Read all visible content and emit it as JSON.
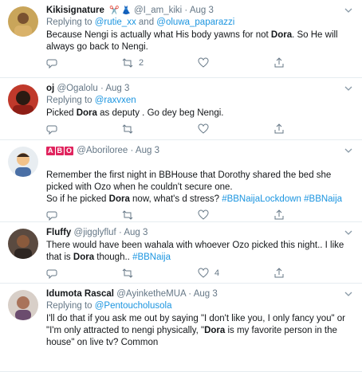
{
  "colors": {
    "link": "#1b95e0",
    "muted": "#657786",
    "divider": "#e6ecf0"
  },
  "tweets": [
    {
      "name": "Kikisignature",
      "emoji": "✂️ 👗",
      "handle": "@I_am_kiki",
      "sep": "·",
      "date": "Aug 3",
      "replying_prefix": "Replying to",
      "replying_handles": [
        "@rutie_xx",
        "and",
        "@oluwa_paparazzi"
      ],
      "body_segments": [
        {
          "t": "Because Nengi is actually what His body yawns for not ",
          "s": "n"
        },
        {
          "t": "Dora",
          "s": "b"
        },
        {
          "t": ". So He will always go back to Nengi.",
          "s": "n"
        }
      ],
      "counts": {
        "reply": "",
        "retweet": "2",
        "like": ""
      }
    },
    {
      "name": "oj",
      "handle": "@Ogalolu",
      "sep": "·",
      "date": "Aug 3",
      "replying_prefix": "Replying to",
      "replying_handles": [
        "@raxvxen"
      ],
      "body_segments": [
        {
          "t": "Picked ",
          "s": "n"
        },
        {
          "t": "Dora",
          "s": "b"
        },
        {
          "t": " as deputy . Go dey beg Nengi.",
          "s": "n"
        }
      ],
      "counts": {
        "reply": "",
        "retweet": "",
        "like": ""
      }
    },
    {
      "name_badges": [
        "A",
        "B",
        "O"
      ],
      "handle": "@Aboriloree",
      "sep": "·",
      "date": "Aug 3",
      "body_segments": [
        {
          "t": "Remember the first night in BBHouse that Dorothy shared the bed she picked with Ozo when he couldn't secure one.",
          "s": "n"
        },
        {
          "t": "\nSo if he picked ",
          "s": "n"
        },
        {
          "t": "Dora",
          "s": "b"
        },
        {
          "t": " now,  what's d stress? ",
          "s": "n"
        },
        {
          "t": "#BBNaijaLockdown",
          "s": "h"
        },
        {
          "t": " ",
          "s": "n"
        },
        {
          "t": "#BBNaija",
          "s": "h"
        }
      ],
      "counts": {
        "reply": "",
        "retweet": "",
        "like": ""
      }
    },
    {
      "name": "Fluffy",
      "handle": "@jigglyfluf",
      "sep": "·",
      "date": "Aug 3",
      "body_segments": [
        {
          "t": "There would have been wahala with whoever Ozo picked this night.. I like that is ",
          "s": "n"
        },
        {
          "t": "Dora",
          "s": "b"
        },
        {
          "t": " though.. ",
          "s": "n"
        },
        {
          "t": "#BBNaija",
          "s": "h"
        }
      ],
      "counts": {
        "reply": "",
        "retweet": "",
        "like": "4"
      }
    },
    {
      "name": "Idumota Rascal",
      "handle": "@AyinketheMUA",
      "sep": "·",
      "date": "Aug 3",
      "replying_prefix": "Replying to",
      "replying_handles": [
        "@Pentoucholusola"
      ],
      "body_segments": [
        {
          "t": "I'll do that if you ask me out by saying \"I don't like you, I only fancy you\" or \"I'm only attracted to nengi physically, \"",
          "s": "n"
        },
        {
          "t": "Dora",
          "s": "b"
        },
        {
          "t": " is my favorite person in the house\" on live tv? Common",
          "s": "n"
        }
      ],
      "counts": {
        "reply": "",
        "retweet": "",
        "like": ""
      }
    }
  ]
}
